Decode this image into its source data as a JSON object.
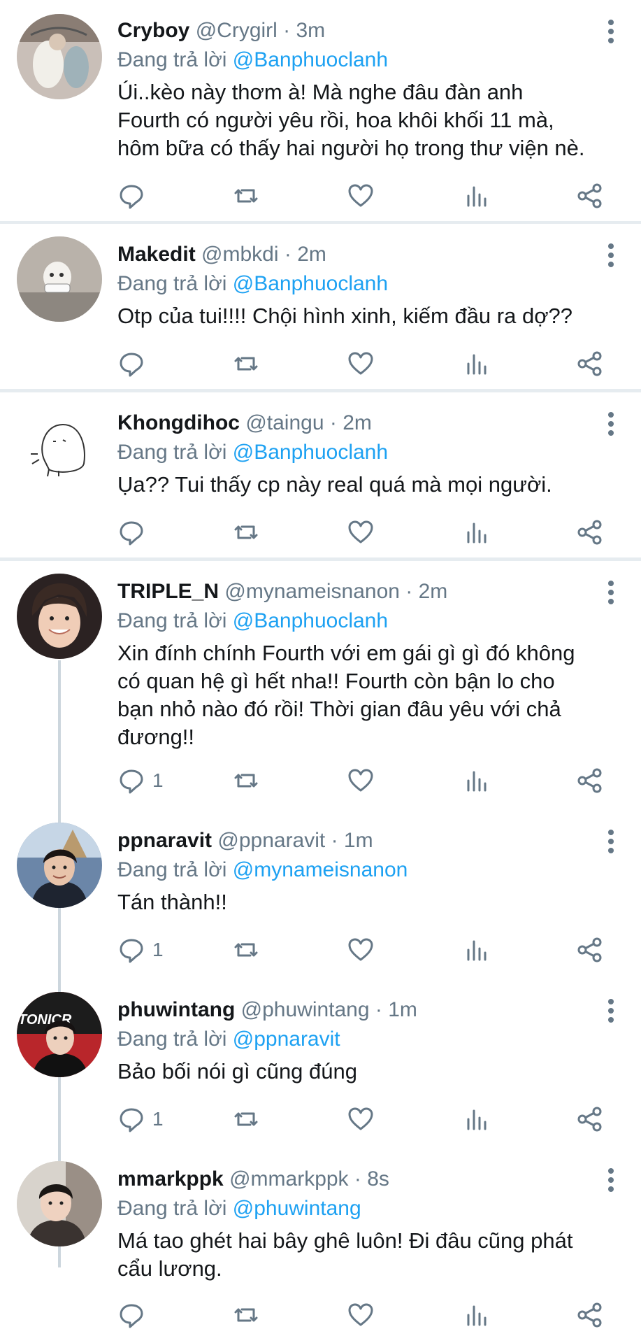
{
  "reply_prefix": "Đang trả lời",
  "tweets": [
    {
      "name": "Cryboy",
      "handle": "@Crygirl",
      "time": "3m",
      "reply_to": "@Banphuoclanh",
      "text": "Úi..kèo này thơm à! Mà nghe đâu đàn anh\nFourth có người yêu rồi, hoa khôi khối 11 mà,\nhôm bữa có thấy hai người họ trong thư viện nè.",
      "reply_count": ""
    },
    {
      "name": "Makedit",
      "handle": "@mbkdi",
      "time": "2m",
      "reply_to": "@Banphuoclanh",
      "text": "Otp của tui!!!! Chội hình xinh, kiếm đầu ra dợ??",
      "reply_count": ""
    },
    {
      "name": "Khongdihoc",
      "handle": "@taingu",
      "time": "2m",
      "reply_to": "@Banphuoclanh",
      "text": "Ụa?? Tui thấy cp này real quá mà mọi người.",
      "reply_count": ""
    },
    {
      "name": "TRIPLE_N",
      "handle": "@mynameisnanon",
      "time": "2m",
      "reply_to": "@Banphuoclanh",
      "text": "Xin đính chính Fourth với em gái gì gì đó không\ncó quan hệ gì hết nha!! Fourth còn bận lo cho\nbạn nhỏ nào đó rồi! Thời gian đâu yêu với chả\nđương!!",
      "reply_count": "1"
    },
    {
      "name": "ppnaravit",
      "handle": "@ppnaravit",
      "time": "1m",
      "reply_to": "@mynameisnanon",
      "text": "Tán thành!!",
      "reply_count": "1"
    },
    {
      "name": "phuwintang",
      "handle": "@phuwintang",
      "time": "1m",
      "reply_to": "@ppnaravit",
      "text": "Bảo bối nói gì cũng đúng",
      "reply_count": "1"
    },
    {
      "name": "mmarkppk",
      "handle": "@mmarkppk",
      "time": "8s",
      "reply_to": "@phuwintang",
      "text": "Má tao ghét hai bây ghê luôn! Đi đâu cũng phát\ncẩu lương.",
      "reply_count": ""
    }
  ],
  "avatar_labels": {
    "phuwintang": "TONICR"
  },
  "icons": [
    "reply-icon",
    "retweet-icon",
    "like-icon",
    "analytics-icon",
    "share-icon",
    "more-icon"
  ],
  "colors": {
    "link": "#1da1f2",
    "secondary_text": "#657786",
    "separator": "#e6ecf0",
    "thread_line": "#ccd6dd"
  }
}
